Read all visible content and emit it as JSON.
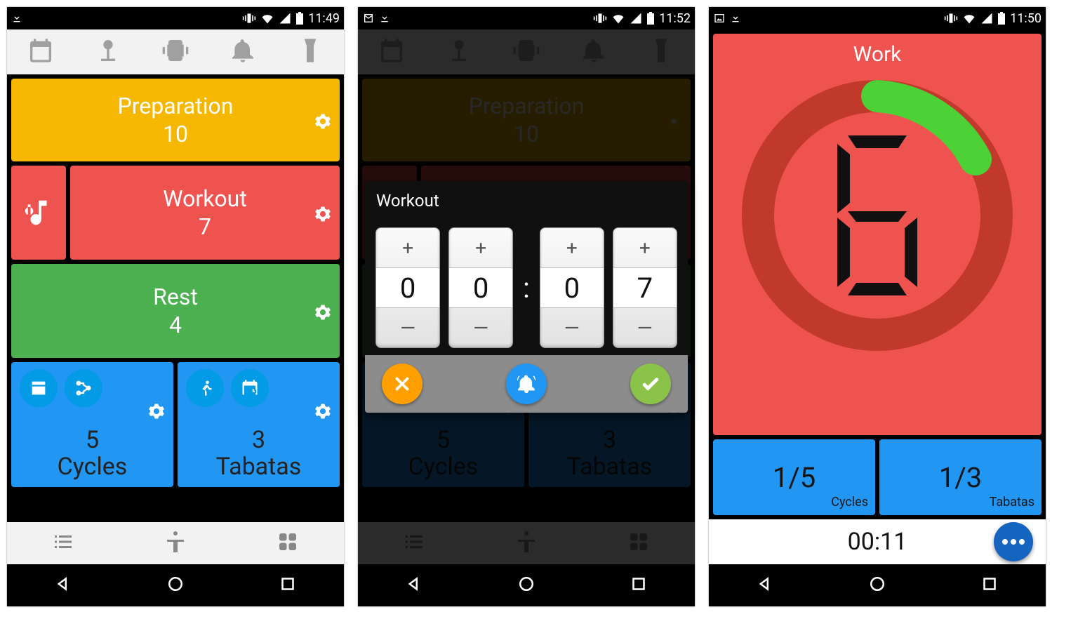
{
  "status": {
    "time1": "11:49",
    "time2": "11:52",
    "time3": "11:50"
  },
  "s1": {
    "prep": {
      "label": "Preparation",
      "value": "10"
    },
    "work": {
      "label": "Workout",
      "value": "7"
    },
    "rest": {
      "label": "Rest",
      "value": "4"
    },
    "cycles": {
      "value": "5",
      "label": "Cycles"
    },
    "tabatas": {
      "value": "3",
      "label": "Tabatas"
    }
  },
  "s2": {
    "modal_title": "Workout",
    "d0": "0",
    "d1": "0",
    "d2": "0",
    "d3": "7",
    "bg": {
      "prep": {
        "label": "Preparation",
        "value": "10"
      },
      "cycles": {
        "value": "5",
        "label": "Cycles"
      },
      "tabatas": {
        "value": "3",
        "label": "Tabatas"
      }
    }
  },
  "s3": {
    "title": "Work",
    "digit": "6",
    "cycles": {
      "value": "1/5",
      "label": "Cycles"
    },
    "tabatas": {
      "value": "1/3",
      "label": "Tabatas"
    },
    "elapsed": "00:11"
  },
  "colors": {
    "prep": "#f5b700",
    "work": "#ef5350",
    "rest": "#4caf50",
    "blue": "#2196f3"
  }
}
